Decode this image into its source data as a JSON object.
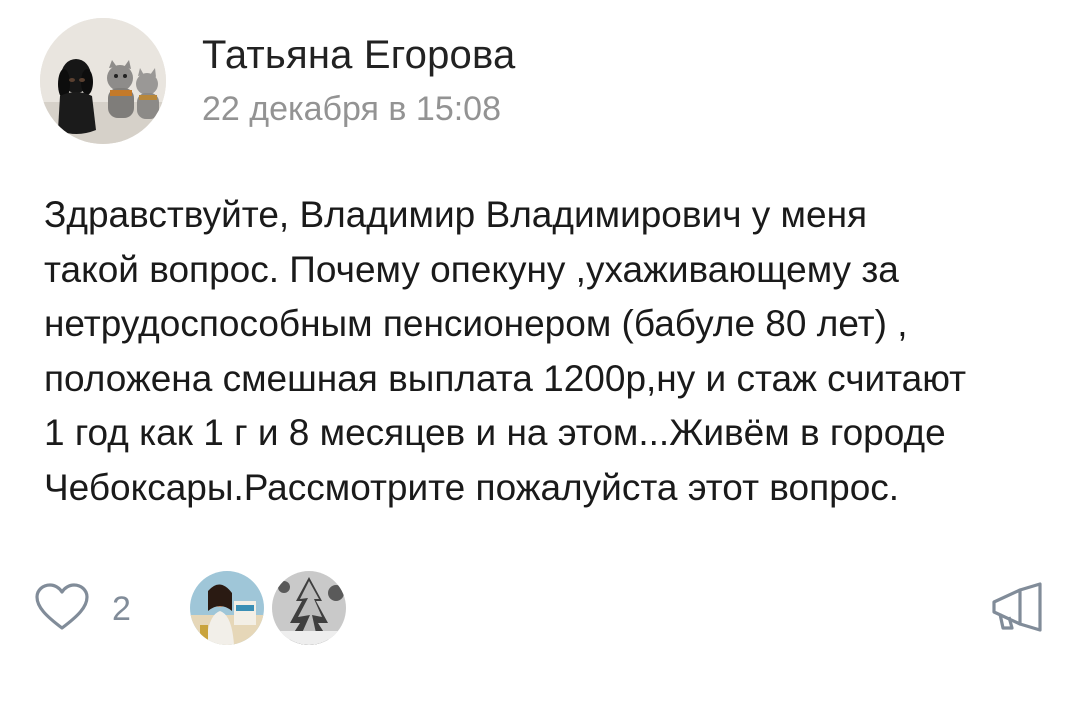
{
  "post": {
    "author": "Татьяна Егорова",
    "timestamp": "22 декабря в 15:08",
    "text": "Здравствуйте, Владимир Владимирович   у меня\nтакой вопрос. Почему  опекуну ,ухаживающему за\nнетрудоспособным пенсионером (бабуле 80 лет) ,\nположена смешная выплата 1200р,ну и стаж считают\n1 год как 1 г и 8 месяцев и на этом...Живём в городе\nЧебоксары.Рассмотрите пожалуйста этот вопрос."
  },
  "footer": {
    "like_icon": "heart-outline-icon",
    "like_count": "2",
    "share_icon": "megaphone-icon",
    "icon_color": "#818c99"
  }
}
